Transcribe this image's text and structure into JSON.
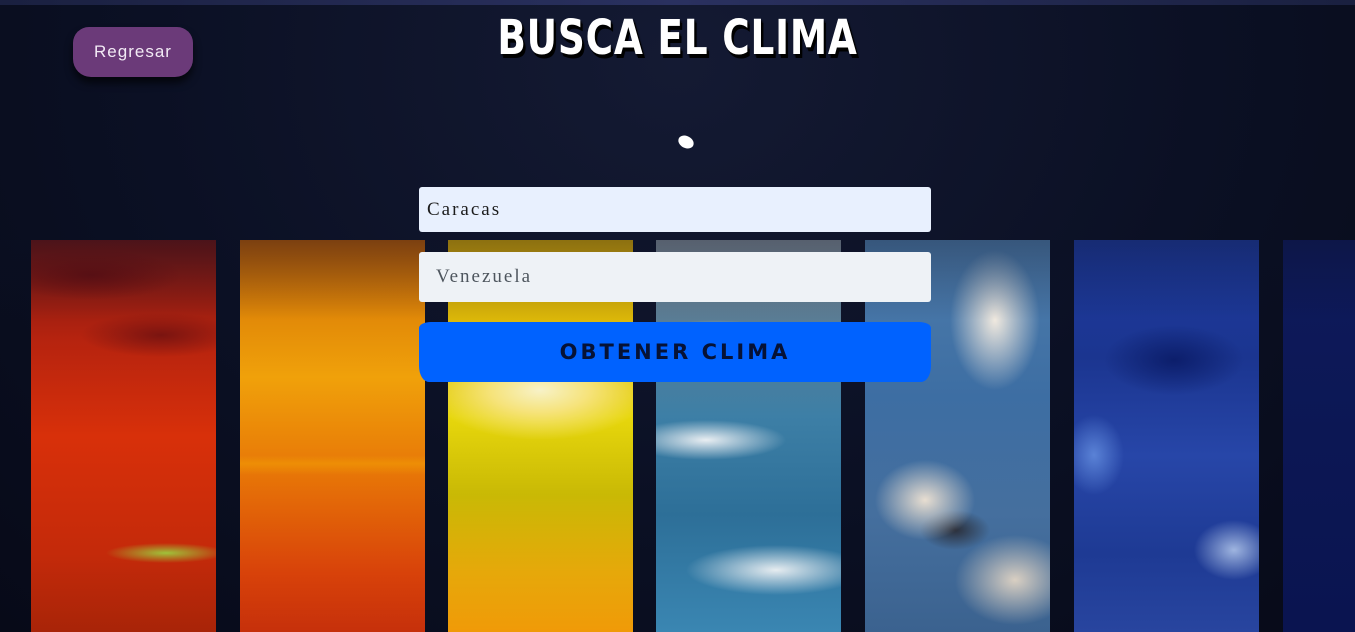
{
  "header": {
    "back_label": "Regresar",
    "title": "BUSCA EL CLIMA"
  },
  "loader": {
    "icon": "loading-spinner-icon"
  },
  "form": {
    "city_value": "Caracas",
    "country_placeholder": "Venezuela",
    "submit_label": "OBTENER CLIMA"
  },
  "background": {
    "strips": [
      "red-sky",
      "orange-sky",
      "yellow-sun-sky",
      "blue-cloudy-sky",
      "cumulus-clouds-sky",
      "deep-blue-sky",
      "night-blue-sky"
    ]
  },
  "colors": {
    "page_background": "#0b1024",
    "back_button": "#6b3a79",
    "submit_button": "#0062ff",
    "city_input_background": "#e8f0fe"
  }
}
